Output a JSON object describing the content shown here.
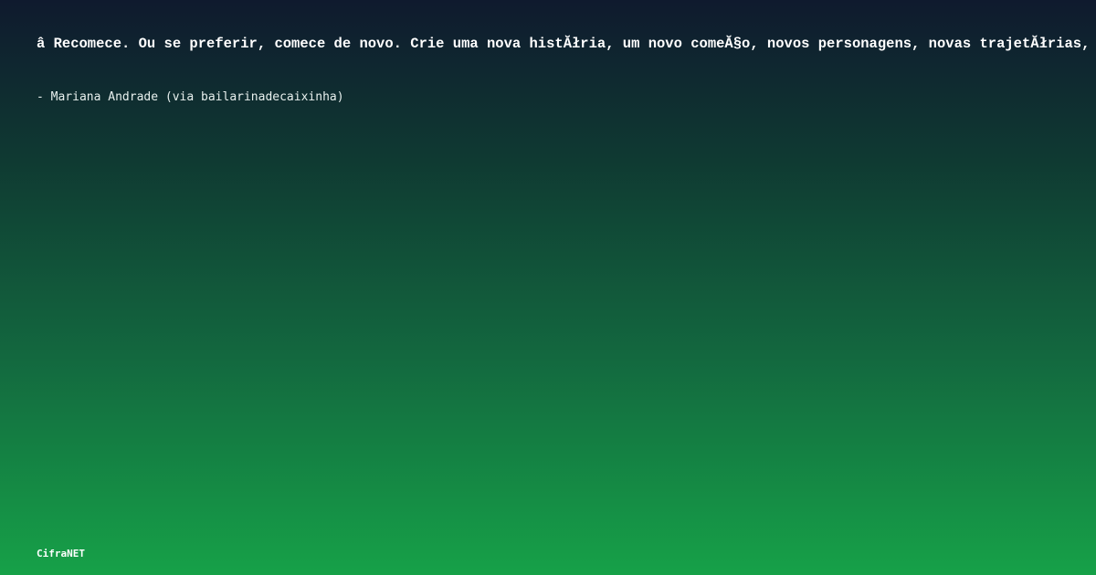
{
  "quote": {
    "text": "â  Recomece. Ou se preferir, comece de novo. Crie uma nova histĂłria, um novo comeĂ§o, novos personagens, novas trajetĂłrias, um",
    "author": "- Mariana Andrade (via bailarinadecaixinha)"
  },
  "brand": {
    "name": "CifraNET"
  },
  "colors": {
    "background_top": "#0f1a2e",
    "background_bottom": "#16a148",
    "text": "#ffffff"
  }
}
